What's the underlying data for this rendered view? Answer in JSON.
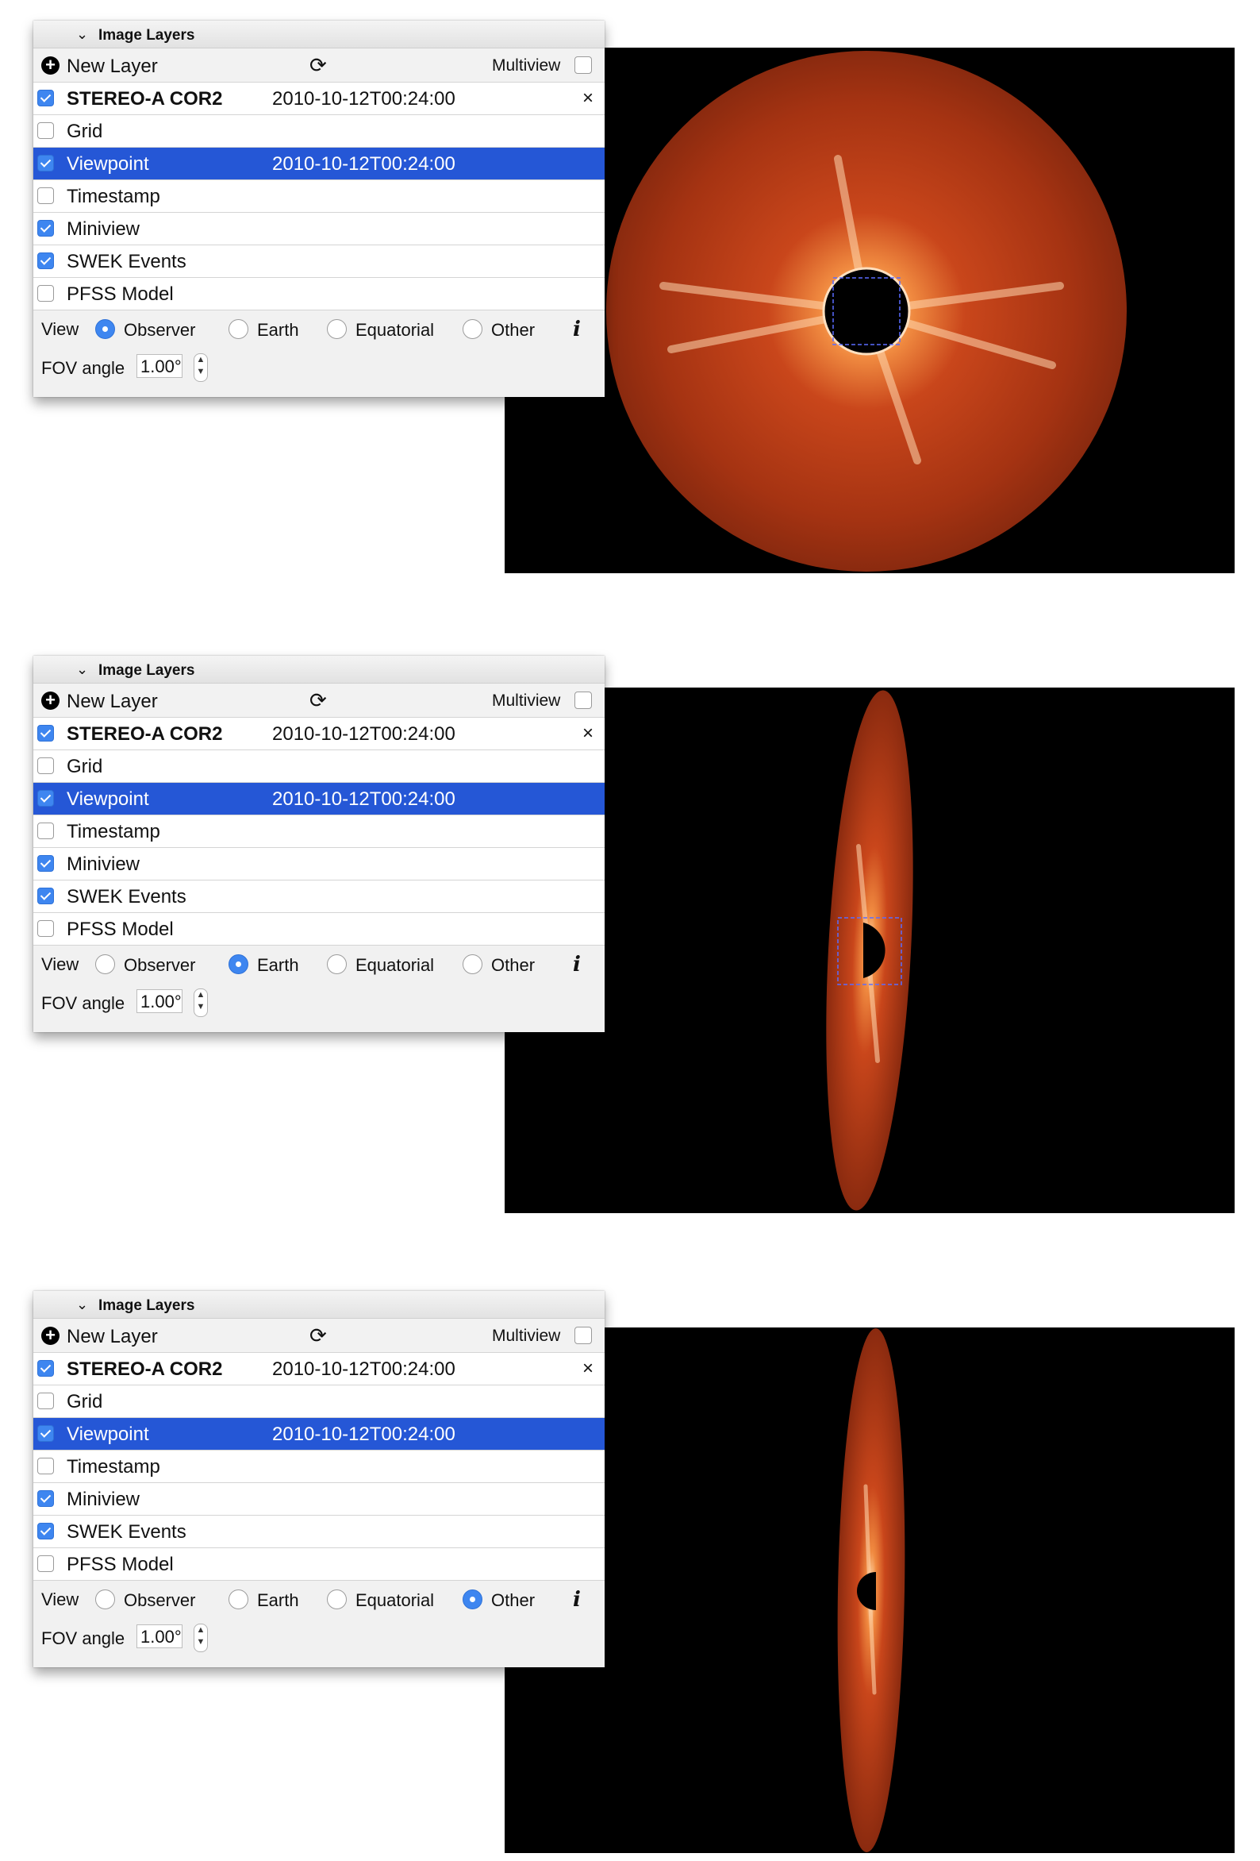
{
  "panels": [
    {
      "title": "Image Layers",
      "toolbar": {
        "new_layer": "New Layer",
        "multiview": "Multiview"
      },
      "layers": [
        {
          "name": "STEREO-A COR2",
          "time": "2010-10-12T00:24:00",
          "close": "×"
        },
        {
          "name": "Grid"
        },
        {
          "name": "Viewpoint",
          "time": "2010-10-12T00:24:00"
        },
        {
          "name": "Timestamp"
        },
        {
          "name": "Miniview"
        },
        {
          "name": "SWEK Events"
        },
        {
          "name": "PFSS Model"
        }
      ],
      "view": {
        "label": "View",
        "observer": "Observer",
        "earth": "Earth",
        "equatorial": "Equatorial",
        "other": "Other",
        "selected": "Observer"
      },
      "fov": {
        "label": "FOV angle",
        "value": "1.00°"
      }
    },
    {
      "title": "Image Layers",
      "toolbar": {
        "new_layer": "New Layer",
        "multiview": "Multiview"
      },
      "layers": [
        {
          "name": "STEREO-A COR2",
          "time": "2010-10-12T00:24:00",
          "close": "×"
        },
        {
          "name": "Grid"
        },
        {
          "name": "Viewpoint",
          "time": "2010-10-12T00:24:00"
        },
        {
          "name": "Timestamp"
        },
        {
          "name": "Miniview"
        },
        {
          "name": "SWEK Events"
        },
        {
          "name": "PFSS Model"
        }
      ],
      "view": {
        "label": "View",
        "observer": "Observer",
        "earth": "Earth",
        "equatorial": "Equatorial",
        "other": "Other",
        "selected": "Earth"
      },
      "fov": {
        "label": "FOV angle",
        "value": "1.00°"
      }
    },
    {
      "title": "Image Layers",
      "toolbar": {
        "new_layer": "New Layer",
        "multiview": "Multiview"
      },
      "layers": [
        {
          "name": "STEREO-A COR2",
          "time": "2010-10-12T00:24:00",
          "close": "×"
        },
        {
          "name": "Grid"
        },
        {
          "name": "Viewpoint",
          "time": "2010-10-12T00:24:00"
        },
        {
          "name": "Timestamp"
        },
        {
          "name": "Miniview"
        },
        {
          "name": "SWEK Events"
        },
        {
          "name": "PFSS Model"
        }
      ],
      "view": {
        "label": "View",
        "observer": "Observer",
        "earth": "Earth",
        "equatorial": "Equatorial",
        "other": "Other",
        "selected": "Other"
      },
      "fov": {
        "label": "FOV angle",
        "value": "1.00°"
      }
    }
  ],
  "layer_checked": [
    true,
    false,
    true,
    false,
    true,
    true,
    false
  ],
  "selected_layer": "Viewpoint",
  "multiview_checked": false,
  "icons": {
    "new_layer": "plus-circle-icon",
    "refresh": "refresh-icon",
    "collapse": "chevron-down-icon",
    "close": "close-icon",
    "info": "info-icon"
  },
  "colors": {
    "selection": "#2557d6",
    "checkbox": "#3e86f0",
    "corona": "#c8401a",
    "background": "#000000"
  }
}
